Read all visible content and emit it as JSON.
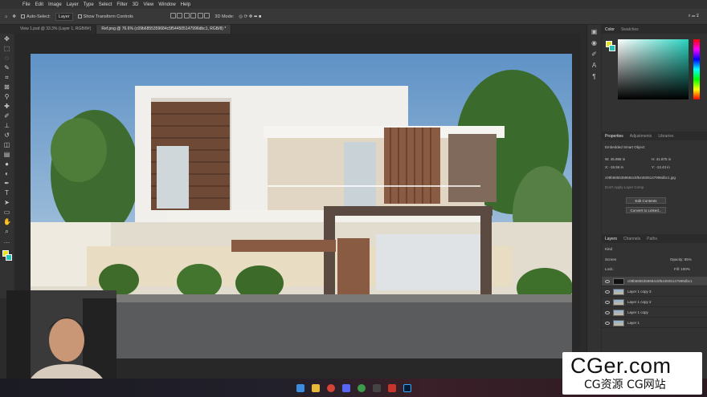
{
  "logo": "165",
  "menu": [
    "File",
    "Edit",
    "Image",
    "Layer",
    "Type",
    "Select",
    "Filter",
    "3D",
    "View",
    "Window",
    "Help"
  ],
  "options": {
    "auto_select_label": "Auto-Select:",
    "auto_select_value": "Layer",
    "transform_label": "Show Transform Controls",
    "mode_label": "3D Mode:"
  },
  "tabs": [
    "View 1.psd @ 33.3% (Layer 1, RGB/8#)",
    "Ref.png @ 76.6% (c09b6855359684c5f544505147996dbc1, RGB/8) *"
  ],
  "panels": {
    "color_tabs": [
      "Color",
      "Swatches"
    ],
    "props_tabs": [
      "Properties",
      "Adjustments",
      "Libraries"
    ],
    "smart_object": "Embedded Smart Object",
    "w_label": "W:",
    "w_value": "45.958 in",
    "h_label": "H:",
    "h_value": "41.875 in",
    "x_label": "X:",
    "x_value": "-15.56 in",
    "y_label": "Y:",
    "y_value": "-13.43 in",
    "filename": "c09b6855359684c5f544505147996dbc1.jpg",
    "comp": "Don't Apply Layer Comp",
    "edit_btn": "Edit Contents",
    "convert_btn": "Convert to Linked...",
    "layers_tabs": [
      "Layers",
      "Channels",
      "Paths"
    ],
    "kind": "Kind",
    "blend": "Screen",
    "opacity_label": "Opacity:",
    "opacity": "85%",
    "lock_label": "Lock:",
    "fill_label": "Fill:",
    "fill": "100%",
    "layers": [
      "c09b6855359684c5f544505147996dbc1",
      "Layer 1 copy 3",
      "Layer 1 copy 2",
      "Layer 1 copy",
      "Layer 1"
    ]
  },
  "watermark": {
    "line1": "CGer.com",
    "line2": "CG资源 CG网站"
  },
  "colors": {
    "fg": "#e6e22a",
    "bg": "#27c2b3",
    "accent": "#31a8ff"
  },
  "taskbar_apps": [
    "start-icon",
    "files-icon",
    "chrome-icon",
    "discord-icon",
    "chrome-icon",
    "app-icon",
    "app-icon",
    "photoshop-icon"
  ]
}
